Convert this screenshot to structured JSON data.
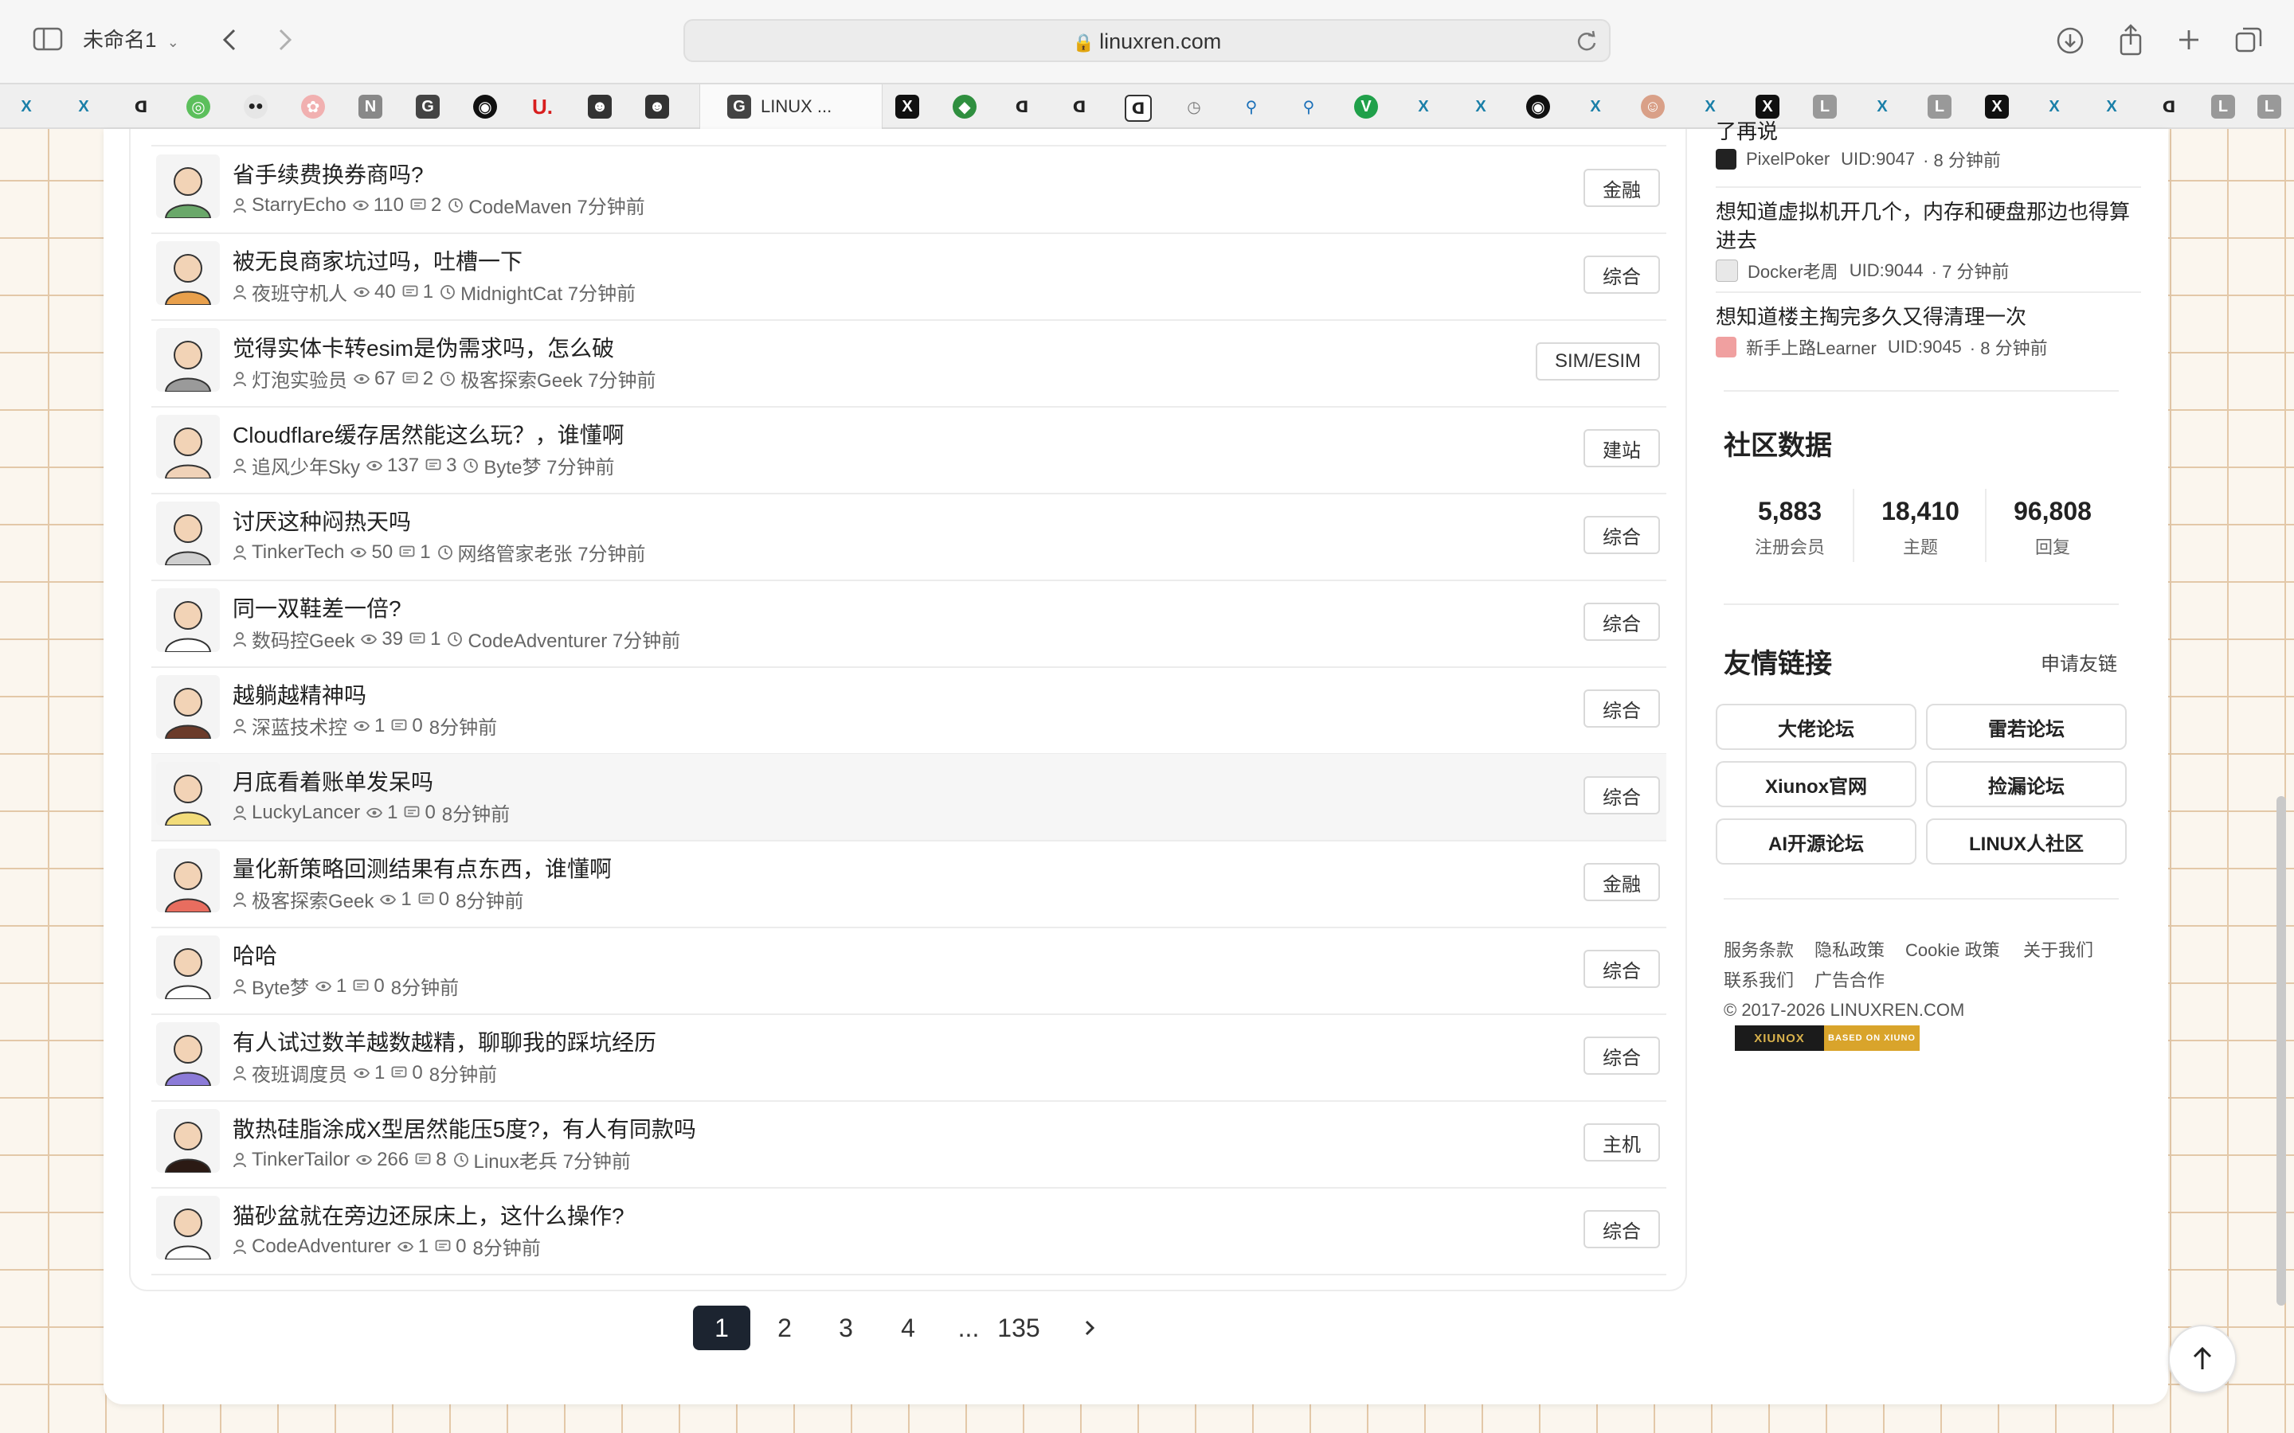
{
  "browser": {
    "window_title": "未命名1",
    "url": "linuxren.com",
    "active_tab_label": "LINUX ..."
  },
  "topics": [
    {
      "title": "省手续费换券商吗?",
      "author": "StarryEcho",
      "views": "110",
      "replies": "2",
      "last": "CodeMaven 7分钟前",
      "tag": "金融",
      "avatar_color": "#6aa86a"
    },
    {
      "title": "被无良商家坑过吗，吐槽一下",
      "author": "夜班守机人",
      "views": "40",
      "replies": "1",
      "last": "MidnightCat 7分钟前",
      "tag": "综合",
      "avatar_color": "#e8a04c"
    },
    {
      "title": "觉得实体卡转esim是伪需求吗，怎么破",
      "author": "灯泡实验员",
      "views": "67",
      "replies": "2",
      "last": "极客探索Geek 7分钟前",
      "tag": "SIM/ESIM",
      "avatar_color": "#9a9a9a"
    },
    {
      "title": "Cloudflare缓存居然能这么玩？，谁懂啊",
      "author": "追风少年Sky",
      "views": "137",
      "replies": "3",
      "last": "Byte梦 7分钟前",
      "tag": "建站",
      "avatar_color": "#f0d2b8"
    },
    {
      "title": "讨厌这种闷热天吗",
      "author": "TinkerTech",
      "views": "50",
      "replies": "1",
      "last": "网络管家老张 7分钟前",
      "tag": "综合",
      "avatar_color": "#cfcfcf"
    },
    {
      "title": "同一双鞋差一倍?",
      "author": "数码控Geek",
      "views": "39",
      "replies": "1",
      "last": "CodeAdventurer 7分钟前",
      "tag": "综合",
      "avatar_color": "#ffffff"
    },
    {
      "title": "越躺越精神吗",
      "author": "深蓝技术控",
      "views": "1",
      "replies": "0",
      "last": "8分钟前",
      "tag": "综合",
      "avatar_color": "#6b3b2a"
    },
    {
      "title": "月底看着账单发呆吗",
      "author": "LuckyLancer",
      "views": "1",
      "replies": "0",
      "last": "8分钟前",
      "tag": "综合",
      "avatar_color": "#f2dc7a"
    },
    {
      "title": "量化新策略回测结果有点东西，谁懂啊",
      "author": "极客探索Geek",
      "views": "1",
      "replies": "0",
      "last": "8分钟前",
      "tag": "金融",
      "avatar_color": "#e86d5f"
    },
    {
      "title": "哈哈",
      "author": "Byte梦",
      "views": "1",
      "replies": "0",
      "last": "8分钟前",
      "tag": "综合",
      "avatar_color": "#ffffff"
    },
    {
      "title": "有人试过数羊越数越精，聊聊我的踩坑经历",
      "author": "夜班调度员",
      "views": "1",
      "replies": "0",
      "last": "8分钟前",
      "tag": "综合",
      "avatar_color": "#8c7bd8"
    },
    {
      "title": "散热硅脂涂成X型居然能压5度?，有人有同款吗",
      "author": "TinkerTailor",
      "views": "266",
      "replies": "8",
      "last": "Linux老兵 7分钟前",
      "tag": "主机",
      "avatar_color": "#2b1a14"
    },
    {
      "title": "猫砂盆就在旁边还尿床上，这什么操作?",
      "author": "CodeAdventurer",
      "views": "1",
      "replies": "0",
      "last": "8分钟前",
      "tag": "综合",
      "avatar_color": "#ffffff"
    }
  ],
  "pagination": {
    "pages": [
      "1",
      "2",
      "3",
      "4"
    ],
    "ellipsis": "...",
    "last_page": "135",
    "current": "1"
  },
  "sidebar": {
    "recent": [
      {
        "title": "了再说",
        "user": "PixelPoker",
        "uid": "UID:9047",
        "time": "· 8 分钟前"
      },
      {
        "title": "想知道虚拟机开几个，内存和硬盘那边也得算进去",
        "user": "Docker老周",
        "uid": "UID:9044",
        "time": "· 7 分钟前"
      },
      {
        "title": "想知道楼主掏完多久又得清理一次",
        "user": "新手上路Learner",
        "uid": "UID:9045",
        "time": "· 8 分钟前"
      }
    ],
    "stats_title": "社区数据",
    "stats": [
      {
        "value": "5,883",
        "label": "注册会员"
      },
      {
        "value": "18,410",
        "label": "主题"
      },
      {
        "value": "96,808",
        "label": "回复"
      }
    ],
    "links_title": "友情链接",
    "apply_link": "申请友链",
    "links": [
      "大佬论坛",
      "雷若论坛",
      "Xiunox官网",
      "捡漏论坛",
      "AI开源论坛",
      "LINUX人社区"
    ],
    "footer_links": [
      "服务条款",
      "隐私政策",
      "Cookie 政策",
      "关于我们",
      "联系我们",
      "广告合作"
    ],
    "copyright": "© 2017-2026 LINUXREN.COM",
    "badge_left": "XIUNOX",
    "badge_right": "BASED ON XIUNO"
  }
}
